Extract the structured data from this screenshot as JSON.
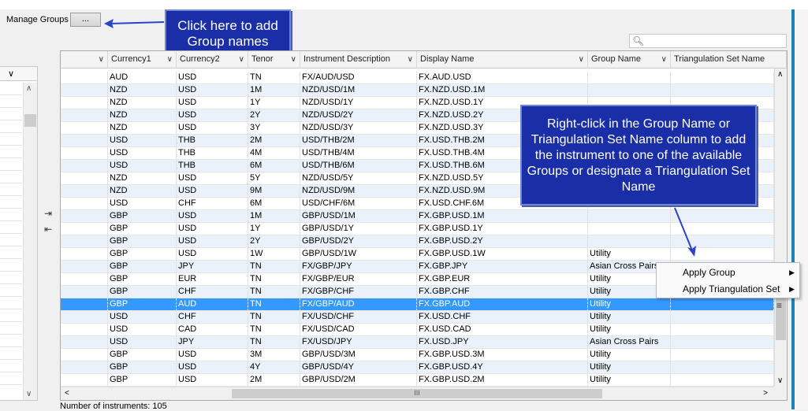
{
  "manage_groups": {
    "label": "Manage Groups",
    "button": "..."
  },
  "callouts": {
    "add_group": "Click here to add Group names",
    "right_click": "Right-click in the Group Name or Triangulation Set Name column to add the instrument to one of the available Groups or designate a Triangulation Set Name"
  },
  "columns": [
    "",
    "Currency1",
    "Currency2",
    "Tenor",
    "Instrument Description",
    "Display Name",
    "Group Name",
    "Triangulation Set Name"
  ],
  "rows": [
    {
      "c1": "AUD",
      "c2": "USD",
      "tenor": "TN",
      "desc": "FX/AUD/USD",
      "display": "FX.AUD.USD",
      "group": "",
      "tri": ""
    },
    {
      "c1": "NZD",
      "c2": "USD",
      "tenor": "1M",
      "desc": "NZD/USD/1M",
      "display": "FX.NZD.USD.1M",
      "group": "",
      "tri": ""
    },
    {
      "c1": "NZD",
      "c2": "USD",
      "tenor": "1Y",
      "desc": "NZD/USD/1Y",
      "display": "FX.NZD.USD.1Y",
      "group": "",
      "tri": ""
    },
    {
      "c1": "NZD",
      "c2": "USD",
      "tenor": "2Y",
      "desc": "NZD/USD/2Y",
      "display": "FX.NZD.USD.2Y",
      "group": "",
      "tri": ""
    },
    {
      "c1": "NZD",
      "c2": "USD",
      "tenor": "3Y",
      "desc": "NZD/USD/3Y",
      "display": "FX.NZD.USD.3Y",
      "group": "",
      "tri": ""
    },
    {
      "c1": "USD",
      "c2": "THB",
      "tenor": "2M",
      "desc": "USD/THB/2M",
      "display": "FX.USD.THB.2M",
      "group": "",
      "tri": ""
    },
    {
      "c1": "USD",
      "c2": "THB",
      "tenor": "4M",
      "desc": "USD/THB/4M",
      "display": "FX.USD.THB.4M",
      "group": "",
      "tri": ""
    },
    {
      "c1": "USD",
      "c2": "THB",
      "tenor": "6M",
      "desc": "USD/THB/6M",
      "display": "FX.USD.THB.6M",
      "group": "",
      "tri": ""
    },
    {
      "c1": "NZD",
      "c2": "USD",
      "tenor": "5Y",
      "desc": "NZD/USD/5Y",
      "display": "FX.NZD.USD.5Y",
      "group": "",
      "tri": ""
    },
    {
      "c1": "NZD",
      "c2": "USD",
      "tenor": "9M",
      "desc": "NZD/USD/9M",
      "display": "FX.NZD.USD.9M",
      "group": "",
      "tri": ""
    },
    {
      "c1": "USD",
      "c2": "CHF",
      "tenor": "6M",
      "desc": "USD/CHF/6M",
      "display": "FX.USD.CHF.6M",
      "group": "",
      "tri": ""
    },
    {
      "c1": "GBP",
      "c2": "USD",
      "tenor": "1M",
      "desc": "GBP/USD/1M",
      "display": "FX.GBP.USD.1M",
      "group": "",
      "tri": ""
    },
    {
      "c1": "GBP",
      "c2": "USD",
      "tenor": "1Y",
      "desc": "GBP/USD/1Y",
      "display": "FX.GBP.USD.1Y",
      "group": "",
      "tri": ""
    },
    {
      "c1": "GBP",
      "c2": "USD",
      "tenor": "2Y",
      "desc": "GBP/USD/2Y",
      "display": "FX.GBP.USD.2Y",
      "group": "",
      "tri": ""
    },
    {
      "c1": "GBP",
      "c2": "USD",
      "tenor": "1W",
      "desc": "GBP/USD/1W",
      "display": "FX.GBP.USD.1W",
      "group": "Utility",
      "tri": ""
    },
    {
      "c1": "GBP",
      "c2": "JPY",
      "tenor": "TN",
      "desc": "FX/GBP/JPY",
      "display": "FX.GBP.JPY",
      "group": "Asian Cross Pairs",
      "tri": ""
    },
    {
      "c1": "GBP",
      "c2": "EUR",
      "tenor": "TN",
      "desc": "FX/GBP/EUR",
      "display": "FX.GBP.EUR",
      "group": "Utility",
      "tri": ""
    },
    {
      "c1": "GBP",
      "c2": "CHF",
      "tenor": "TN",
      "desc": "FX/GBP/CHF",
      "display": "FX.GBP.CHF",
      "group": "Utility",
      "tri": ""
    },
    {
      "c1": "GBP",
      "c2": "AUD",
      "tenor": "TN",
      "desc": "FX/GBP/AUD",
      "display": "FX.GBP.AUD",
      "group": "Utility",
      "tri": "",
      "selected": true
    },
    {
      "c1": "USD",
      "c2": "CHF",
      "tenor": "TN",
      "desc": "FX/USD/CHF",
      "display": "FX.USD.CHF",
      "group": "Utility",
      "tri": ""
    },
    {
      "c1": "USD",
      "c2": "CAD",
      "tenor": "TN",
      "desc": "FX/USD/CAD",
      "display": "FX.USD.CAD",
      "group": "Utility",
      "tri": ""
    },
    {
      "c1": "USD",
      "c2": "JPY",
      "tenor": "TN",
      "desc": "FX/USD/JPY",
      "display": "FX.USD.JPY",
      "group": "Asian Cross Pairs",
      "tri": ""
    },
    {
      "c1": "GBP",
      "c2": "USD",
      "tenor": "3M",
      "desc": "GBP/USD/3M",
      "display": "FX.GBP.USD.3M",
      "group": "Utility",
      "tri": ""
    },
    {
      "c1": "GBP",
      "c2": "USD",
      "tenor": "4Y",
      "desc": "GBP/USD/4Y",
      "display": "FX.GBP.USD.4Y",
      "group": "Utility",
      "tri": ""
    },
    {
      "c1": "GBP",
      "c2": "USD",
      "tenor": "2M",
      "desc": "GBP/USD/2M",
      "display": "FX.GBP.USD.2M",
      "group": "Utility",
      "tri": ""
    }
  ],
  "context_menu": {
    "apply_group": "Apply Group",
    "apply_triangulation": "Apply Triangulation Set"
  },
  "footer": {
    "count": "Number of instruments: 105"
  },
  "colors": {
    "callout": "#1a2ea8",
    "selection": "#3399ff",
    "alt_row": "#eaf1fa"
  },
  "icons": [
    "search-icon",
    "chevron-down-icon",
    "move-right-icon",
    "move-left-icon",
    "submenu-arrow-icon"
  ]
}
